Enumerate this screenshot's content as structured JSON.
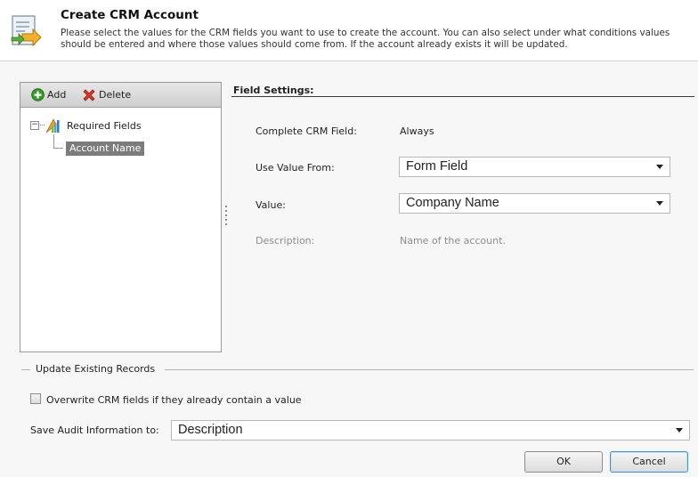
{
  "header": {
    "title": "Create CRM Account",
    "description": "Please select the values for the CRM fields you want to use to create the account. You can also select under what conditions values should be entered and where those values should come from. If the account already exists it will be updated."
  },
  "toolbar": {
    "add_label": "Add",
    "delete_label": "Delete"
  },
  "tree": {
    "root_label": "Required Fields",
    "root_expander": "−",
    "selected_item": "Account Name"
  },
  "field_settings": {
    "title": "Field Settings:",
    "complete_label": "Complete CRM Field:",
    "complete_value": "Always",
    "use_value_from_label": "Use Value From:",
    "use_value_from_selected": "Form Field",
    "value_label": "Value:",
    "value_selected": "Company Name",
    "description_label": "Description:",
    "description_value": "Name of the account."
  },
  "update_existing": {
    "group_title": "Update Existing Records",
    "overwrite_label": "Overwrite CRM fields if they already contain a value",
    "overwrite_checked": false,
    "audit_label": "Save Audit Information to:",
    "audit_selected": "Description"
  },
  "buttons": {
    "ok_label": "OK",
    "cancel_label": "Cancel"
  },
  "icons": {
    "header": "form-arrow-icon",
    "add": "add-icon",
    "delete": "delete-icon",
    "tree_root": "required-fields-icon"
  },
  "colors": {
    "selection": "#7c7c7c",
    "add_green": "#3a9a2a",
    "delete_red": "#d83b2a"
  }
}
